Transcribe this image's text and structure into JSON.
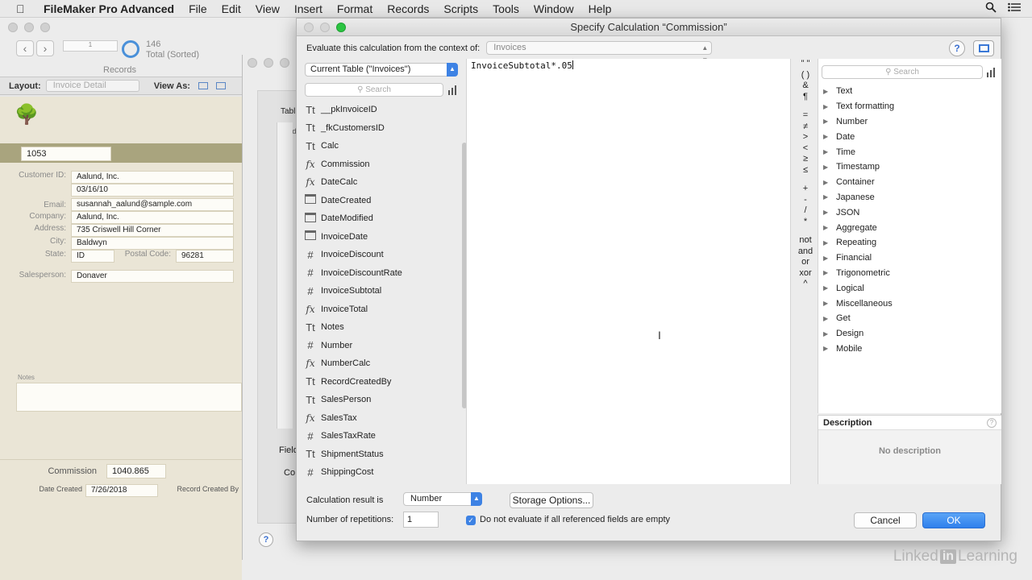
{
  "menubar": {
    "app_name": "FileMaker Pro Advanced",
    "items": [
      "File",
      "Edit",
      "View",
      "Insert",
      "Format",
      "Records",
      "Scripts",
      "Tools",
      "Window",
      "Help"
    ]
  },
  "bg_window": {
    "record_count": "146",
    "record_status": "Total (Sorted)",
    "records_label": "Records",
    "layout_label": "Layout:",
    "layout_value": "Invoice Detail",
    "view_as_label": "View As:",
    "invoice_number": "1053",
    "customer_id_label": "Customer ID:",
    "customer_id": "Aalund, Inc.",
    "date": "03/16/10",
    "email_label": "Email:",
    "email": "susannah_aalund@sample.com",
    "company_label": "Company:",
    "company": "Aalund, Inc.",
    "address_label": "Address:",
    "address": "735 Criswell Hill Corner",
    "city_label": "City:",
    "city": "Baldwyn",
    "state_label": "State:",
    "state": "ID",
    "postal_label": "Postal Code:",
    "postal": "96281",
    "salesperson_label": "Salesperson:",
    "salesperson": "Donaver",
    "notes_label": "Notes",
    "commission_label": "Commission",
    "commission": "1040.865",
    "date_created_label": "Date Created",
    "date_created": "7/26/2018",
    "record_created_by_label": "Record Created By"
  },
  "middle_window": {
    "tab_label": "Tabl",
    "field_col": "Field",
    "field_label2": "Field",
    "co_label": "Co"
  },
  "dialog": {
    "title": "Specify Calculation “Commission”",
    "context_label": "Evaluate this calculation from the context of:",
    "context_value": "Invoices",
    "help": "?",
    "table_select": "Current Table (\"Invoices\")",
    "field_search_placeholder": "Search",
    "fields": [
      {
        "type": "text",
        "name": "__pkInvoiceID"
      },
      {
        "type": "text",
        "name": "_fkCustomersID"
      },
      {
        "type": "text",
        "name": "Calc"
      },
      {
        "type": "calc",
        "name": "Commission"
      },
      {
        "type": "calc",
        "name": "DateCalc"
      },
      {
        "type": "date",
        "name": "DateCreated"
      },
      {
        "type": "timestamp",
        "name": "DateModified"
      },
      {
        "type": "date",
        "name": "InvoiceDate"
      },
      {
        "type": "number",
        "name": "InvoiceDiscount"
      },
      {
        "type": "number",
        "name": "InvoiceDiscountRate"
      },
      {
        "type": "number",
        "name": "InvoiceSubtotal"
      },
      {
        "type": "calc",
        "name": "InvoiceTotal"
      },
      {
        "type": "text",
        "name": "Notes"
      },
      {
        "type": "number",
        "name": "Number"
      },
      {
        "type": "calc",
        "name": "NumberCalc"
      },
      {
        "type": "text",
        "name": "RecordCreatedBy"
      },
      {
        "type": "text",
        "name": "SalesPerson"
      },
      {
        "type": "calc",
        "name": "SalesTax"
      },
      {
        "type": "number",
        "name": "SalesTaxRate"
      },
      {
        "type": "text",
        "name": "ShipmentStatus"
      },
      {
        "type": "number",
        "name": "ShippingCost"
      }
    ],
    "formula": "InvoiceSubtotal*.05",
    "operators": [
      "\" \"",
      "( )",
      "&",
      "¶",
      "",
      "=",
      "≠",
      ">",
      "<",
      "≥",
      "≤",
      "",
      "+",
      "-",
      "/",
      "*",
      "",
      "not",
      "and",
      "or",
      "xor",
      "^"
    ],
    "function_search_placeholder": "Search",
    "functions": [
      "Text",
      "Text formatting",
      "Number",
      "Date",
      "Time",
      "Timestamp",
      "Container",
      "Japanese",
      "JSON",
      "Aggregate",
      "Repeating",
      "Financial",
      "Trigonometric",
      "Logical",
      "Miscellaneous",
      "Get",
      "Design",
      "Mobile"
    ],
    "description_header": "Description",
    "description_body": "No description",
    "result_label": "Calculation result is",
    "result_value": "Number",
    "storage_button": "Storage Options...",
    "reps_label": "Number of repetitions:",
    "reps_value": "1",
    "checkbox_label": "Do not evaluate if all referenced fields are empty",
    "cancel": "Cancel",
    "ok": "OK"
  },
  "watermark": {
    "left": "Linked",
    "badge": "in",
    "right": "Learning"
  }
}
